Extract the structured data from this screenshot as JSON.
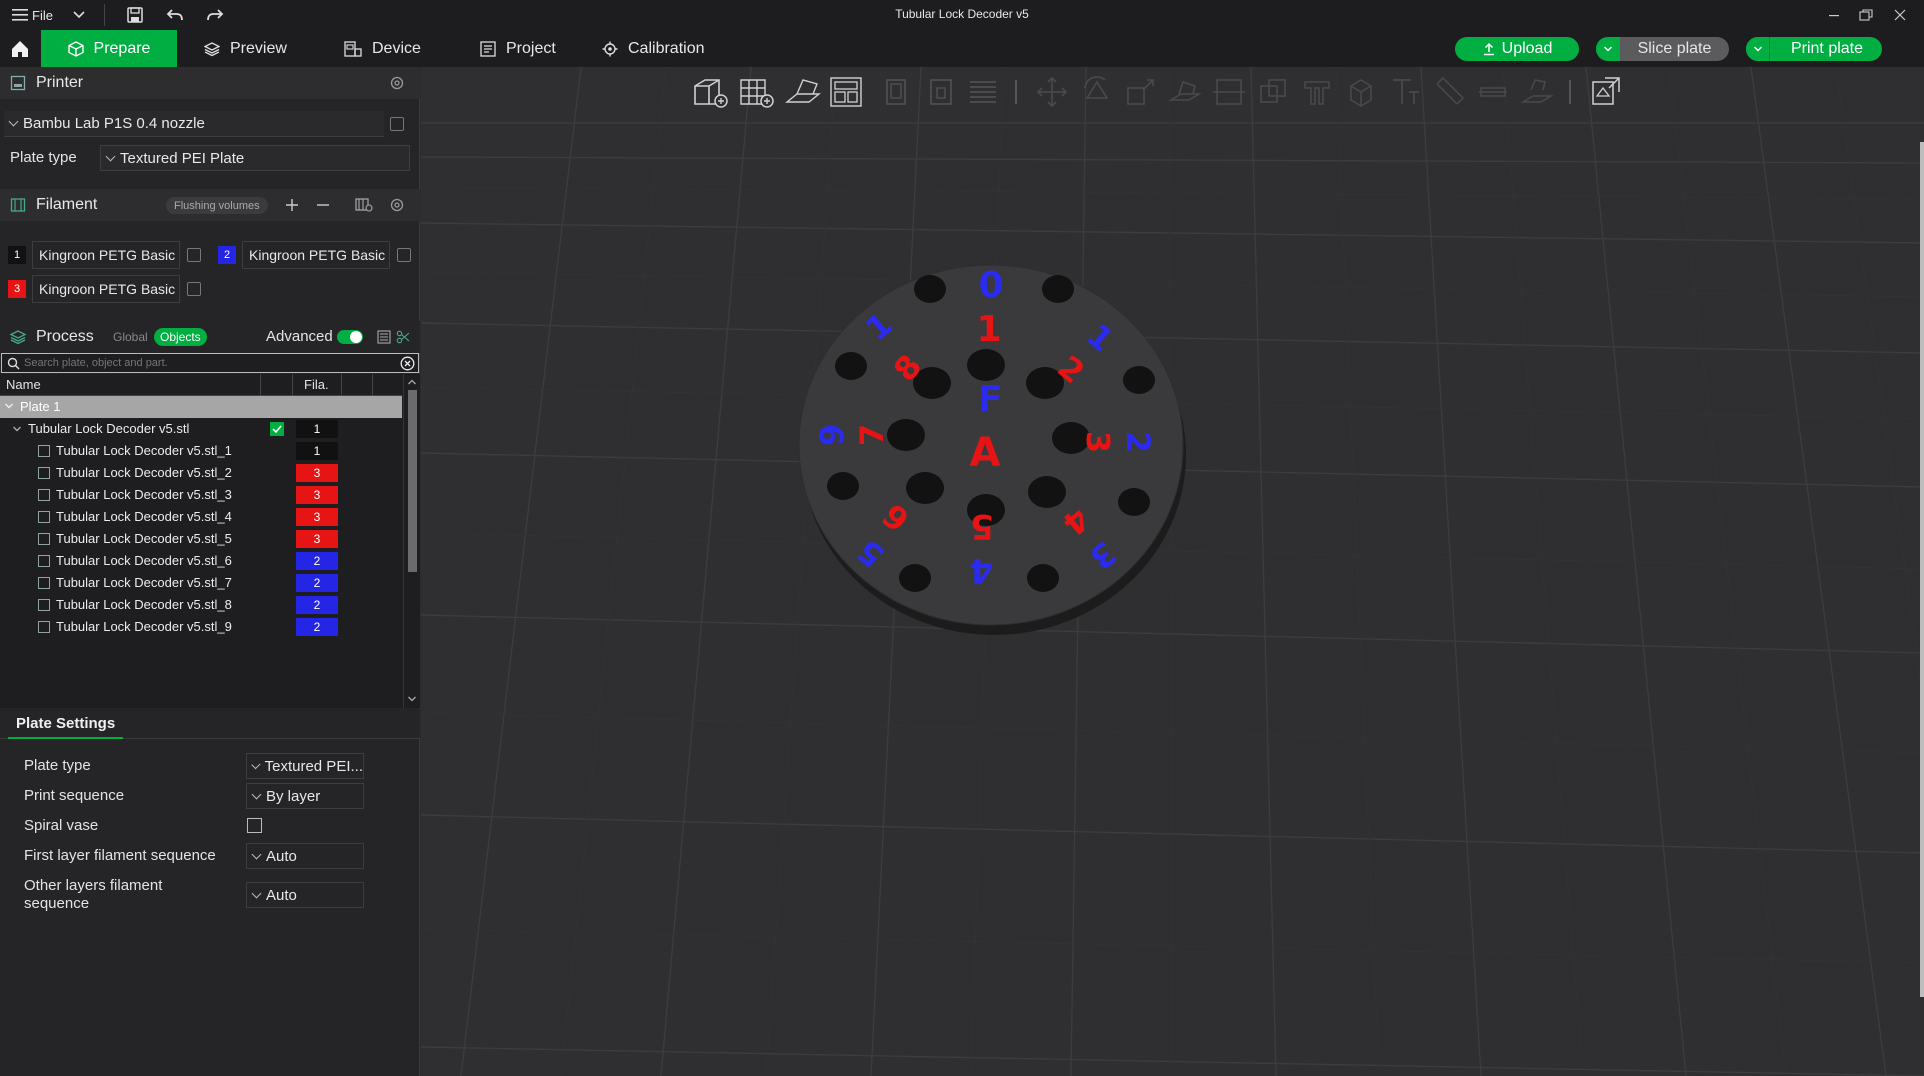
{
  "window": {
    "title": "Tubular Lock Decoder v5",
    "file_menu": "File"
  },
  "nav": {
    "tabs": [
      {
        "label": "Prepare"
      },
      {
        "label": "Preview"
      },
      {
        "label": "Device"
      },
      {
        "label": "Project"
      },
      {
        "label": "Calibration"
      }
    ],
    "upload_label": "Upload",
    "slice_label": "Slice plate",
    "print_label": "Print plate"
  },
  "printer": {
    "section_title": "Printer",
    "name": "Bambu Lab P1S 0.4 nozzle",
    "plate_type_label": "Plate type",
    "plate_type_value": "Textured PEI Plate"
  },
  "filament": {
    "section_title": "Filament",
    "flushing_label": "Flushing volumes",
    "items": [
      {
        "num": "1",
        "name": "Kingroon PETG Basic",
        "color": "#111111"
      },
      {
        "num": "2",
        "name": "Kingroon PETG Basic",
        "color": "#2525e6"
      },
      {
        "num": "3",
        "name": "Kingroon PETG Basic",
        "color": "#e61414"
      }
    ]
  },
  "process": {
    "section_title": "Process",
    "global_label": "Global",
    "objects_label": "Objects",
    "advanced_label": "Advanced",
    "search_placeholder": "Search plate, object and part."
  },
  "object_list": {
    "col_name": "Name",
    "col_fila": "Fila.",
    "plate_label": "Plate 1",
    "object": {
      "name": "Tubular Lock Decoder v5.stl",
      "fila": "1"
    },
    "parts": [
      {
        "name": "Tubular Lock Decoder v5.stl_1",
        "fila": "1",
        "color": "#111111"
      },
      {
        "name": "Tubular Lock Decoder v5.stl_2",
        "fila": "3",
        "color": "#e61414"
      },
      {
        "name": "Tubular Lock Decoder v5.stl_3",
        "fila": "3",
        "color": "#e61414"
      },
      {
        "name": "Tubular Lock Decoder v5.stl_4",
        "fila": "3",
        "color": "#e61414"
      },
      {
        "name": "Tubular Lock Decoder v5.stl_5",
        "fila": "3",
        "color": "#e61414"
      },
      {
        "name": "Tubular Lock Decoder v5.stl_6",
        "fila": "2",
        "color": "#2525e6"
      },
      {
        "name": "Tubular Lock Decoder v5.stl_7",
        "fila": "2",
        "color": "#2525e6"
      },
      {
        "name": "Tubular Lock Decoder v5.stl_8",
        "fila": "2",
        "color": "#2525e6"
      },
      {
        "name": "Tubular Lock Decoder v5.stl_9",
        "fila": "2",
        "color": "#2525e6"
      }
    ]
  },
  "plate_settings": {
    "tab_label": "Plate Settings",
    "plate_type_label": "Plate type",
    "plate_type_value": "Textured PEI...",
    "print_sequence_label": "Print sequence",
    "print_sequence_value": "By layer",
    "spiral_vase_label": "Spiral vase",
    "first_layer_label": "First layer filament sequence",
    "first_layer_value": "Auto",
    "other_layers_label_1": "Other layers filament",
    "other_layers_label_2": "sequence",
    "other_layers_value": "Auto"
  },
  "model": {
    "labels": [
      {
        "text": "0",
        "color": "blue"
      },
      {
        "text": "1",
        "color": "red"
      },
      {
        "text": "F",
        "color": "blue"
      },
      {
        "text": "A",
        "color": "red"
      },
      {
        "text": "5",
        "color": "red"
      },
      {
        "text": "4",
        "color": "blue"
      },
      {
        "text": "1",
        "color": "blue"
      },
      {
        "text": "8",
        "color": "red"
      },
      {
        "text": "2",
        "color": "red"
      },
      {
        "text": "1",
        "color": "blue"
      },
      {
        "text": "9",
        "color": "blue"
      },
      {
        "text": "7",
        "color": "red"
      },
      {
        "text": "3",
        "color": "red"
      },
      {
        "text": "2",
        "color": "blue"
      },
      {
        "text": "6",
        "color": "red"
      },
      {
        "text": "5",
        "color": "blue"
      },
      {
        "text": "4",
        "color": "red"
      },
      {
        "text": "3",
        "color": "blue"
      }
    ]
  },
  "colors": {
    "accent": "#00ae42",
    "red": "#e61414",
    "blue": "#2525e6"
  }
}
